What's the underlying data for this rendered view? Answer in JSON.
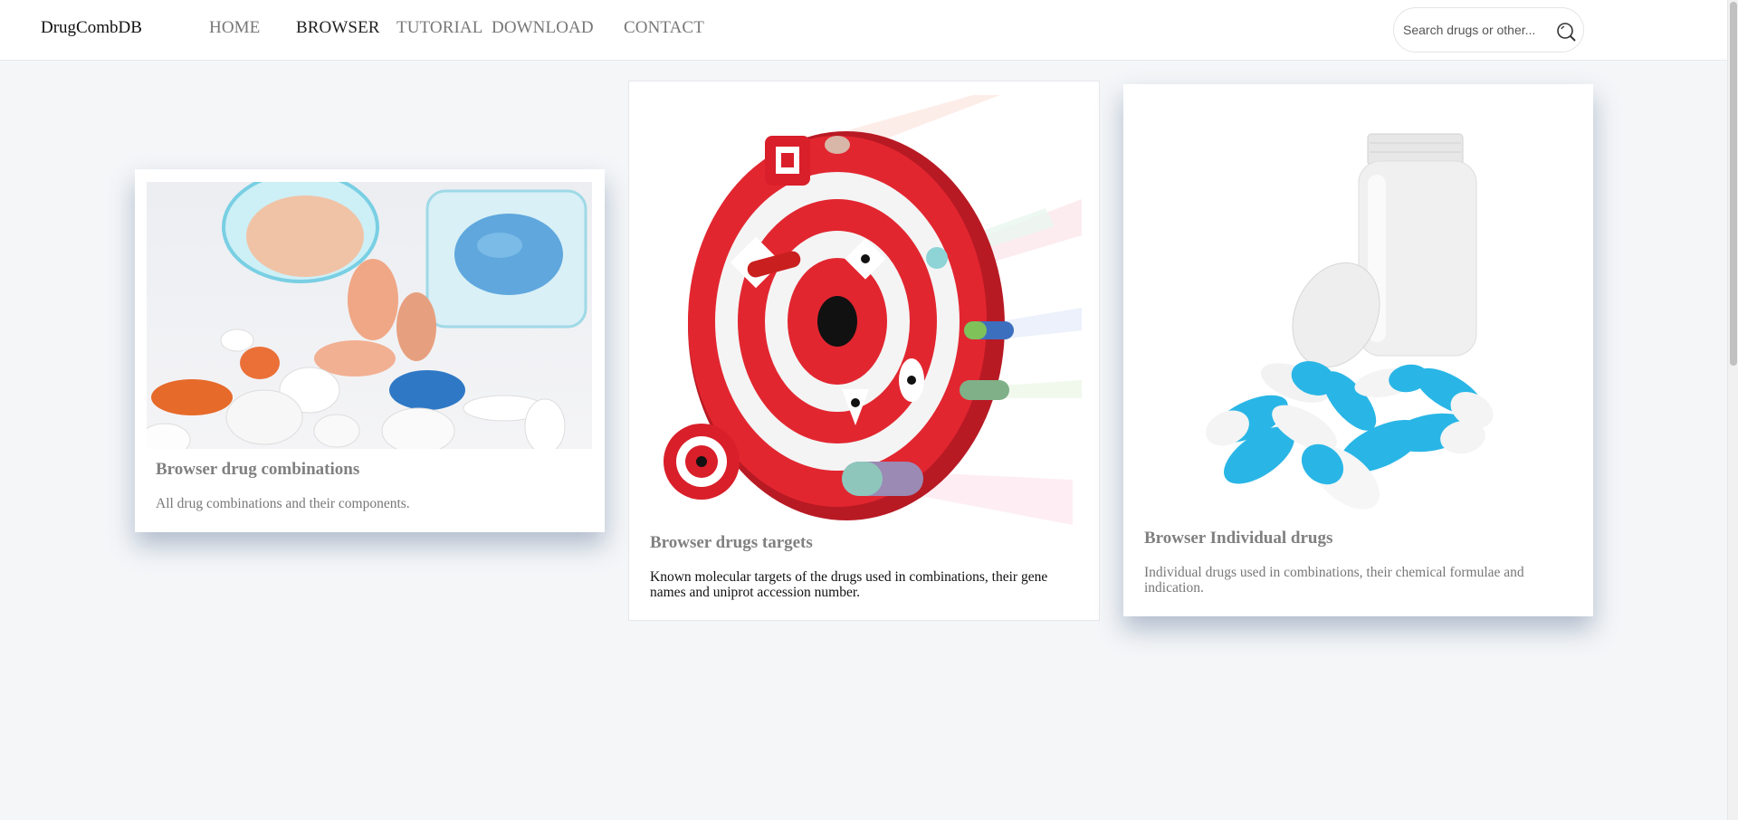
{
  "header": {
    "brand": "DrugCombDB",
    "nav": [
      {
        "label": "HOME",
        "active": false
      },
      {
        "label": "BROWSER",
        "active": true
      },
      {
        "label": "TUTORIAL",
        "active": false
      },
      {
        "label": "DOWNLOAD",
        "active": false
      },
      {
        "label": "CONTACT",
        "active": false
      }
    ],
    "search": {
      "placeholder": "Search drugs or other...",
      "icon": "search-icon"
    }
  },
  "cards": [
    {
      "title": "Browser drug combinations",
      "description": "All drug combinations and their components.",
      "image": "pill-bottles-photo"
    },
    {
      "title": "Browser drugs targets",
      "description": "Known molecular targets of the drugs used in combinations, their gene names and uniprot accession number.",
      "image": "target-pills-illustration"
    },
    {
      "title": "Browser Individual drugs",
      "description": "Individual drugs used in combinations, their chemical formulae and indication.",
      "image": "capsules-bottle-photo"
    }
  ]
}
